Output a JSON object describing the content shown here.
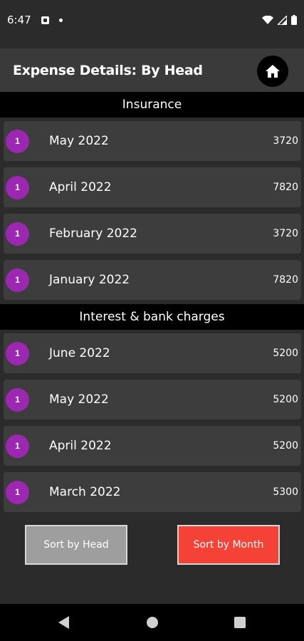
{
  "status_bar": {
    "time": "6:47"
  },
  "app_bar": {
    "title": "Expense Details: By Head"
  },
  "sections": [
    {
      "header": "Insurance",
      "rows": [
        {
          "count": "1",
          "label": "May 2022",
          "amount": "3720"
        },
        {
          "count": "1",
          "label": "April 2022",
          "amount": "7820"
        },
        {
          "count": "1",
          "label": "February 2022",
          "amount": "3720"
        },
        {
          "count": "1",
          "label": "January 2022",
          "amount": "7820"
        }
      ]
    },
    {
      "header": "Interest & bank charges",
      "rows": [
        {
          "count": "1",
          "label": "June 2022",
          "amount": "5200"
        },
        {
          "count": "1",
          "label": "May 2022",
          "amount": "5200"
        },
        {
          "count": "1",
          "label": "April 2022",
          "amount": "5200"
        },
        {
          "count": "1",
          "label": "March 2022",
          "amount": "5300"
        }
      ]
    }
  ],
  "buttons": {
    "sort_head": "Sort by Head",
    "sort_month": "Sort by Month"
  },
  "colors": {
    "badge": "#9c27b0",
    "sort_month_bg": "#f44336",
    "sort_head_bg": "#9e9e9e"
  },
  "icons": {
    "home": "home-icon",
    "wifi": "wifi-icon",
    "signal": "signal-icon",
    "battery": "battery-icon"
  }
}
